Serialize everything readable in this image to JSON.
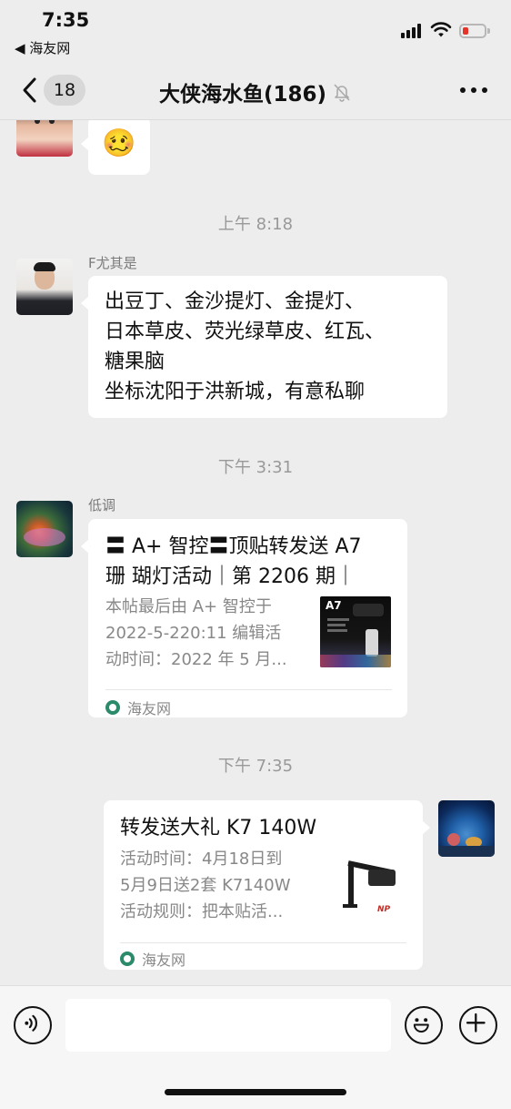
{
  "status_bar": {
    "time": "7:35",
    "back_app": "◀ 海友网"
  },
  "nav": {
    "unread_count": "18",
    "title": "大侠海水鱼(186)"
  },
  "messages": {
    "m1": {
      "content": "🥴"
    },
    "ts1": "上午 8:18",
    "m2": {
      "sender": "F尤其是",
      "text": "出豆丁、金沙提灯、金提灯、\n日本草皮、荧光绿草皮、红瓦、\n糖果脑\n坐标沈阳于洪新城，有意私聊"
    },
    "ts2": "下午 3:31",
    "m3": {
      "sender": "低调",
      "title_line1": "〓 A+ 智控〓顶贴转发送 A7",
      "title_line2": "珊 瑚灯活动｜第 2206 期｜",
      "desc_line1": "本帖最后由 A+ 智控于",
      "desc_line2": "2022-5-220:11 编辑活",
      "desc_line3": "动时间：2022 年 5 月...",
      "thumb_label": "A7",
      "source": "海友网"
    },
    "ts3": "下午 7:35",
    "m4": {
      "title": "转发送大礼 K7 140W",
      "desc_line1": "活动时间：4月18日到",
      "desc_line2": "5月9日送2套 K7140W",
      "desc_line3": "活动规则：把本贴活...",
      "source": "海友网"
    }
  },
  "input_bar": {
    "value": ""
  },
  "colors": {
    "background": "#ededed",
    "bubble": "#ffffff",
    "timestamp": "#999999",
    "battery_low": "#e6332a",
    "source_icon": "#2b8a6a"
  },
  "icons": {
    "voice": "voice-icon",
    "emoji": "emoji-icon",
    "plus": "plus-icon",
    "mute": "mute-bell-icon",
    "more": "more-icon",
    "back": "chevron-left-icon"
  }
}
